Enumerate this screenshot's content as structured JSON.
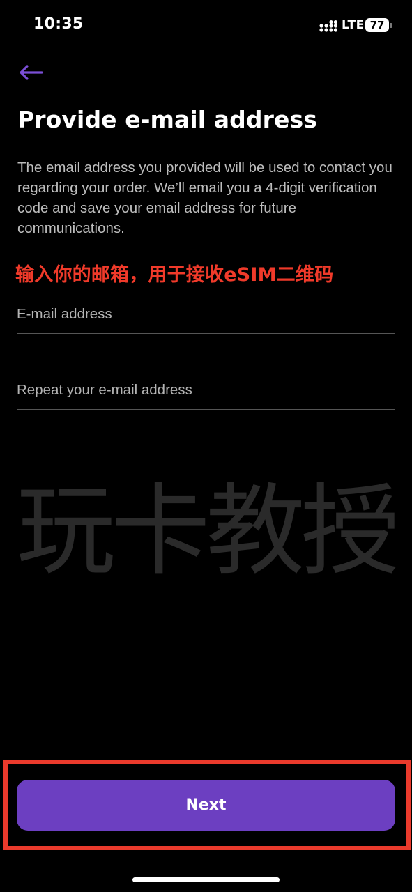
{
  "status_bar": {
    "time": "10:35",
    "network": "LTE",
    "battery_level": "77",
    "signal_icon": "signal-dots-icon"
  },
  "header": {
    "back_icon": "arrow-left-icon",
    "title": "Provide e-mail address"
  },
  "description": "The email address you provided will be used to contact you regarding your order. We’ll email you a 4-digit verification code and save your email address for future communications.",
  "annotation": "输入你的邮箱，用于接收eSIM二维码",
  "form": {
    "email_placeholder": "E-mail address",
    "email_value": "",
    "repeat_placeholder": "Repeat your e-mail address",
    "repeat_value": ""
  },
  "watermark": "玩卡教授",
  "footer": {
    "next_label": "Next"
  },
  "colors": {
    "background": "#000000",
    "accent": "#6c3fc1",
    "annotation_red": "#ea3a2c",
    "back_arrow": "#7b4fd6"
  }
}
